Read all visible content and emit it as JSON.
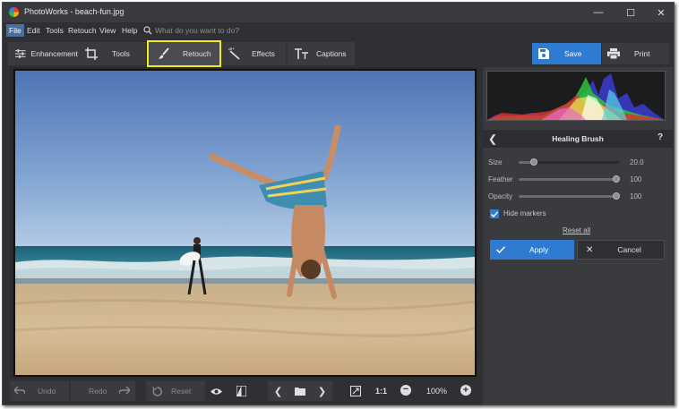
{
  "window": {
    "title": "PhotoWorks - beach-fun.jpg"
  },
  "menu": {
    "items": [
      {
        "label": "File",
        "active": true
      },
      {
        "label": "Edit"
      },
      {
        "label": "Tools"
      },
      {
        "label": "Retouch"
      },
      {
        "label": "View"
      },
      {
        "label": "Help"
      }
    ],
    "search_placeholder": "What do you want to do?"
  },
  "tabs": [
    {
      "label": "Enhancement",
      "icon": "sliders-icon"
    },
    {
      "label": "Tools",
      "icon": "crop-icon"
    },
    {
      "label": "Retouch",
      "icon": "brush-icon",
      "active": true
    },
    {
      "label": "Effects",
      "icon": "magic-wand-icon"
    },
    {
      "label": "Captions",
      "icon": "text-icon"
    }
  ],
  "toolbar": {
    "save_label": "Save",
    "print_label": "Print"
  },
  "bottom": {
    "undo_label": "Undo",
    "redo_label": "Redo",
    "reset_label": "Reset",
    "actual_size_label": "1:1",
    "zoom_value": "100%"
  },
  "panel": {
    "title": "Healing Brush",
    "help": "?",
    "sliders": [
      {
        "label": "Size",
        "value": "20.0",
        "position": 0.18
      },
      {
        "label": "Feather",
        "value": "100",
        "position": 1.0
      },
      {
        "label": "Opacity",
        "value": "100",
        "position": 1.0
      }
    ],
    "hide_markers_label": "Hide markers",
    "hide_markers_checked": true,
    "reset_all_label": "Reset all",
    "apply_label": "Apply",
    "cancel_label": "Cancel"
  },
  "colors": {
    "accent": "#2e7bd1",
    "highlight": "#f3ec1c",
    "panel": "#3a3b3f",
    "background": "#2f3033"
  }
}
